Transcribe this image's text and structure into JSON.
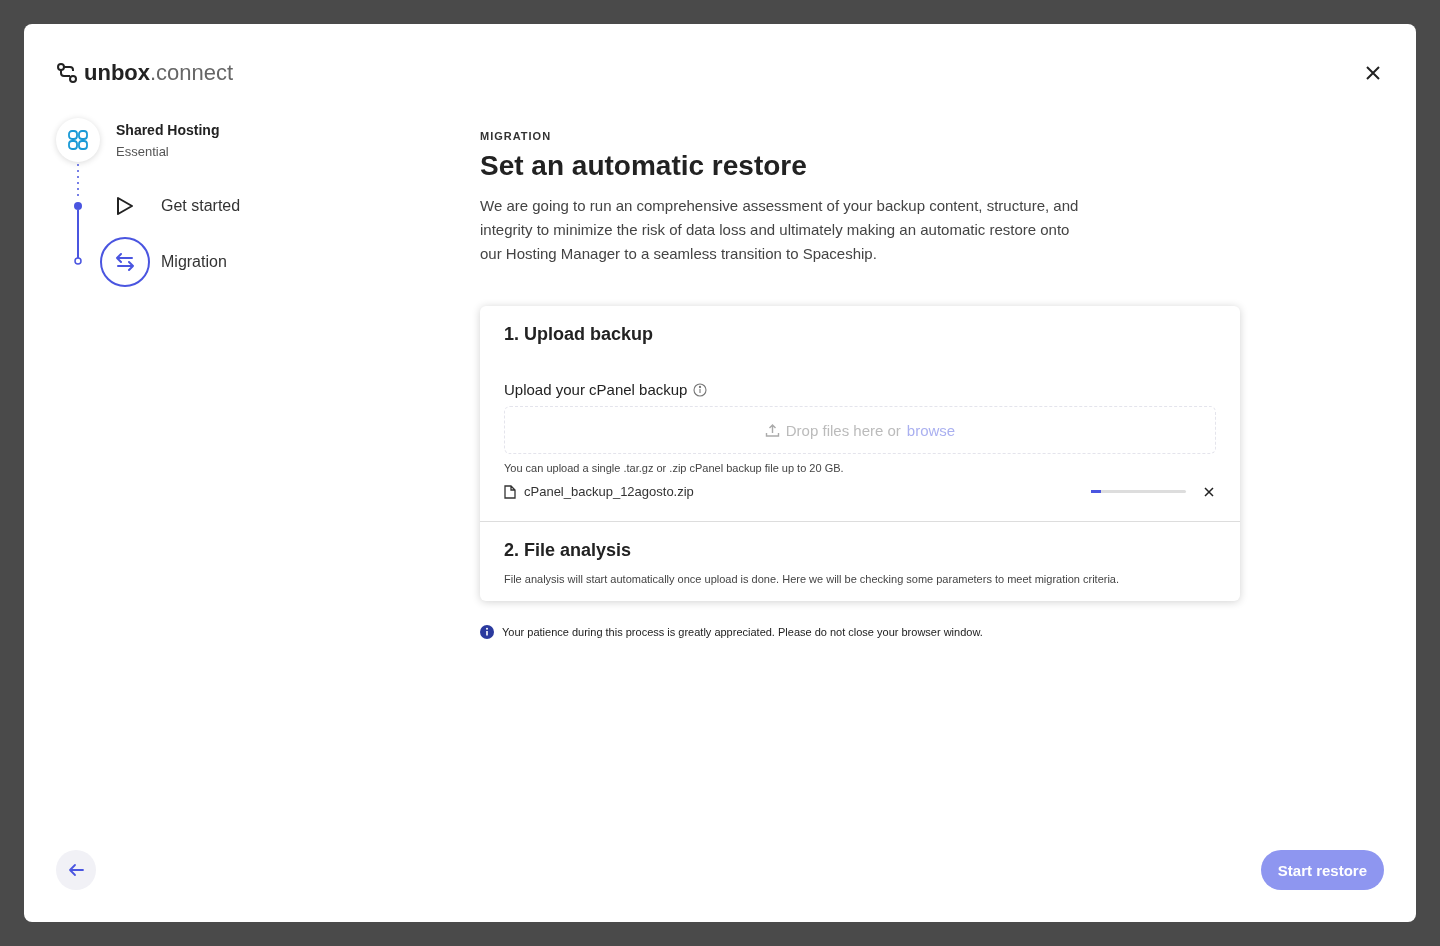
{
  "logo": {
    "text": "**unbox**.connect"
  },
  "plan": {
    "title": "Shared Hosting",
    "subtitle": "Essential"
  },
  "steps": [
    {
      "kind": "play",
      "label": "Get started",
      "selected": false
    },
    {
      "kind": "swap",
      "label": "Migration",
      "selected": true
    }
  ],
  "header": {
    "eyebrow": "MIGRATION",
    "title": "Set an automatic restore",
    "description": "We are going to run an comprehensive assessment of your backup content, structure, and integrity to minimize the risk of data loss and ultimately making an automatic restore onto our Hosting Manager to a seamless transition to Spaceship."
  },
  "upload": {
    "title": "1. Upload backup",
    "field_label": "Upload your cPanel backup",
    "drop_text": "Drop files here or",
    "browse": "browse",
    "hint": "You can upload a single .tar.gz or .zip cPanel backup file up to 20 GB.",
    "file": {
      "name": "cPanel_backup_12agosto.zip",
      "level": 0.1
    }
  },
  "analysis": {
    "title": "2. File analysis",
    "description": "File analysis will start automatically once upload is done. Here we will be checking some parameters to meet migration criteria."
  },
  "notice": "Your patience during this process is greatly appreciated. Please do not close your browser window.",
  "footer": {
    "primary": {
      "label": "Start restore",
      "disabled": true
    }
  }
}
